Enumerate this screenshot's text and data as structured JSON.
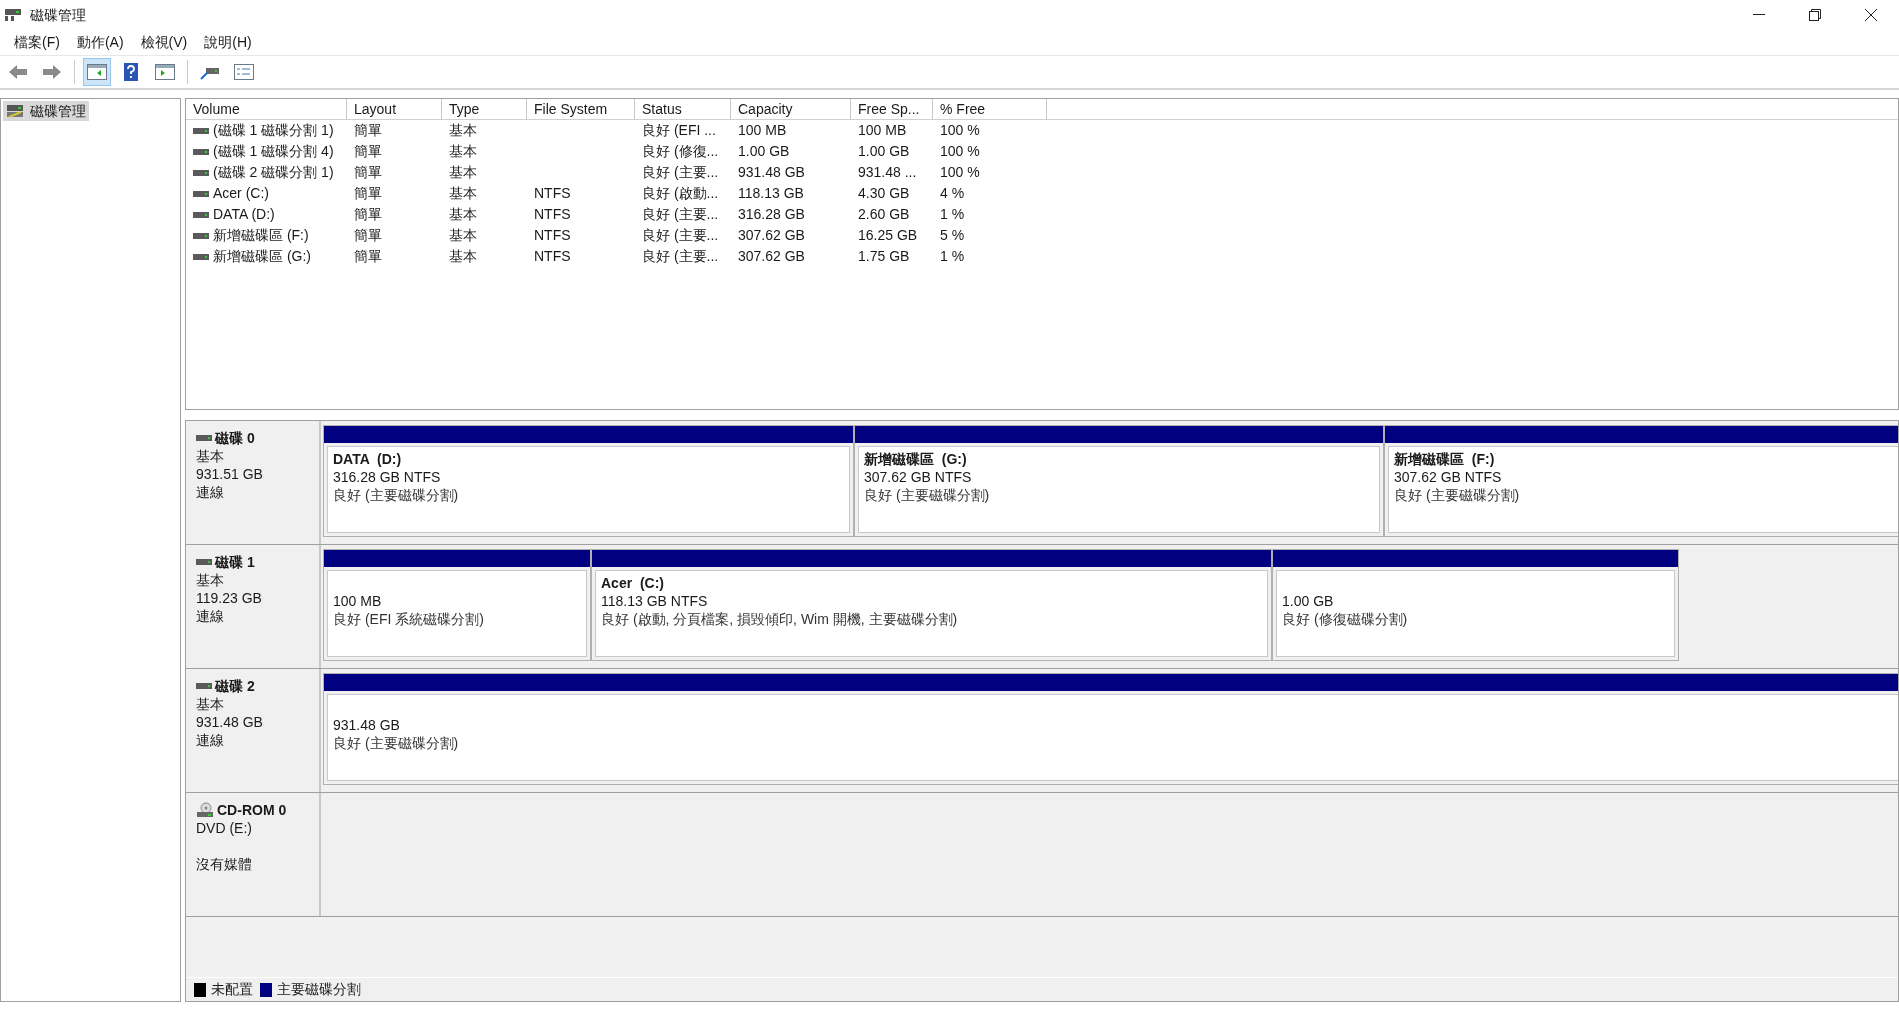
{
  "window": {
    "title": "磁碟管理"
  },
  "menu": [
    "檔案(F)",
    "動作(A)",
    "檢視(V)",
    "說明(H)"
  ],
  "toolbar": [
    {
      "kind": "back",
      "selected": false
    },
    {
      "kind": "forward",
      "selected": false
    },
    {
      "kind": "tree",
      "selected": true
    },
    {
      "kind": "help",
      "selected": false
    },
    {
      "kind": "pane",
      "selected": false
    },
    {
      "kind": "connect",
      "selected": false
    },
    {
      "kind": "props",
      "selected": false
    }
  ],
  "sidebar": {
    "items": [
      {
        "label": "磁碟管理",
        "selected": true
      }
    ]
  },
  "table": {
    "columns": [
      "Volume",
      "Layout",
      "Type",
      "File System",
      "Status",
      "Capacity",
      "Free Sp...",
      "% Free"
    ],
    "rows": [
      [
        "(磁碟 1 磁碟分割 1)",
        "簡單",
        "基本",
        "",
        "良好 (EFI ...",
        "100 MB",
        "100 MB",
        "100 %"
      ],
      [
        "(磁碟 1 磁碟分割 4)",
        "簡單",
        "基本",
        "",
        "良好 (修復...",
        "1.00 GB",
        "1.00 GB",
        "100 %"
      ],
      [
        "(磁碟 2 磁碟分割 1)",
        "簡單",
        "基本",
        "",
        "良好 (主要...",
        "931.48 GB",
        "931.48 ...",
        "100 %"
      ],
      [
        "Acer (C:)",
        "簡單",
        "基本",
        "NTFS",
        "良好 (啟動...",
        "118.13 GB",
        "4.30 GB",
        "4 %"
      ],
      [
        "DATA (D:)",
        "簡單",
        "基本",
        "NTFS",
        "良好 (主要...",
        "316.28 GB",
        "2.60 GB",
        "1 %"
      ],
      [
        "新增磁碟區 (F:)",
        "簡單",
        "基本",
        "NTFS",
        "良好 (主要...",
        "307.62 GB",
        "16.25 GB",
        "5 %"
      ],
      [
        "新增磁碟區 (G:)",
        "簡單",
        "基本",
        "NTFS",
        "良好 (主要...",
        "307.62 GB",
        "1.75 GB",
        "1 %"
      ]
    ]
  },
  "disks": [
    {
      "kind": "disk",
      "name": "磁碟 0",
      "type": "基本",
      "size": "931.51 GB",
      "status": "連線",
      "partitions": [
        {
          "name": "DATA  (D:)",
          "size": "316.28 GB NTFS",
          "status": "良好 (主要磁碟分割)"
        },
        {
          "name": "新增磁碟區  (G:)",
          "size": "307.62 GB NTFS",
          "status": "良好 (主要磁碟分割)"
        },
        {
          "name": "新增磁碟區  (F:)",
          "size": "307.62 GB NTFS",
          "status": "良好 (主要磁碟分割)"
        }
      ]
    },
    {
      "kind": "disk",
      "name": "磁碟 1",
      "type": "基本",
      "size": "119.23 GB",
      "status": "連線",
      "partitions": [
        {
          "size": "100 MB",
          "status": "良好 (EFI 系統磁碟分割)"
        },
        {
          "name": "Acer  (C:)",
          "size": "118.13 GB NTFS",
          "status": "良好 (啟動, 分頁檔案, 損毀傾印, Wim 開機, 主要磁碟分割)"
        },
        {
          "size": "1.00 GB",
          "status": "良好 (修復磁碟分割)"
        }
      ]
    },
    {
      "kind": "disk",
      "name": "磁碟 2",
      "type": "基本",
      "size": "931.48 GB",
      "status": "連線",
      "partitions": [
        {
          "size": "931.48 GB",
          "status": "良好 (主要磁碟分割)"
        }
      ]
    },
    {
      "kind": "cdrom",
      "name": "CD-ROM 0",
      "type": "DVD (E:)",
      "status": "沒有媒體"
    }
  ],
  "legend": [
    {
      "label": "未配置",
      "color": "#000000"
    },
    {
      "label": "主要磁碟分割",
      "color": "#000080"
    }
  ]
}
